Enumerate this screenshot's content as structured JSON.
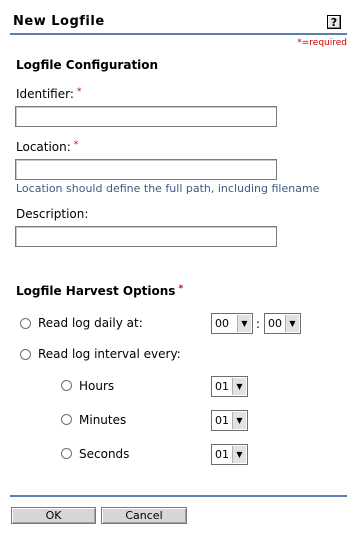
{
  "header": {
    "title": "New Logfile",
    "help_glyph": "?",
    "required_note": "*=required"
  },
  "config": {
    "section_title": "Logfile Configuration",
    "identifier_label": "Identifier:",
    "identifier_value": "",
    "location_label": "Location:",
    "location_value": "",
    "location_hint": "Location should define the full path, including filename",
    "description_label": "Description:",
    "description_value": "",
    "required_marker": "*"
  },
  "harvest": {
    "section_title": "Logfile Harvest Options",
    "required_marker": "*",
    "daily_label": "Read log daily at:",
    "daily_hour": "00",
    "daily_separator": ":",
    "daily_minute": "00",
    "interval_label": "Read log interval every:",
    "hours_label": "Hours",
    "hours_value": "01",
    "minutes_label": "Minutes",
    "minutes_value": "01",
    "seconds_label": "Seconds",
    "seconds_value": "01"
  },
  "footer": {
    "ok_label": "OK",
    "cancel_label": "Cancel"
  },
  "colors": {
    "rule": "#5a7fb0",
    "required": "#cc0000",
    "hint": "#3c5a80"
  }
}
